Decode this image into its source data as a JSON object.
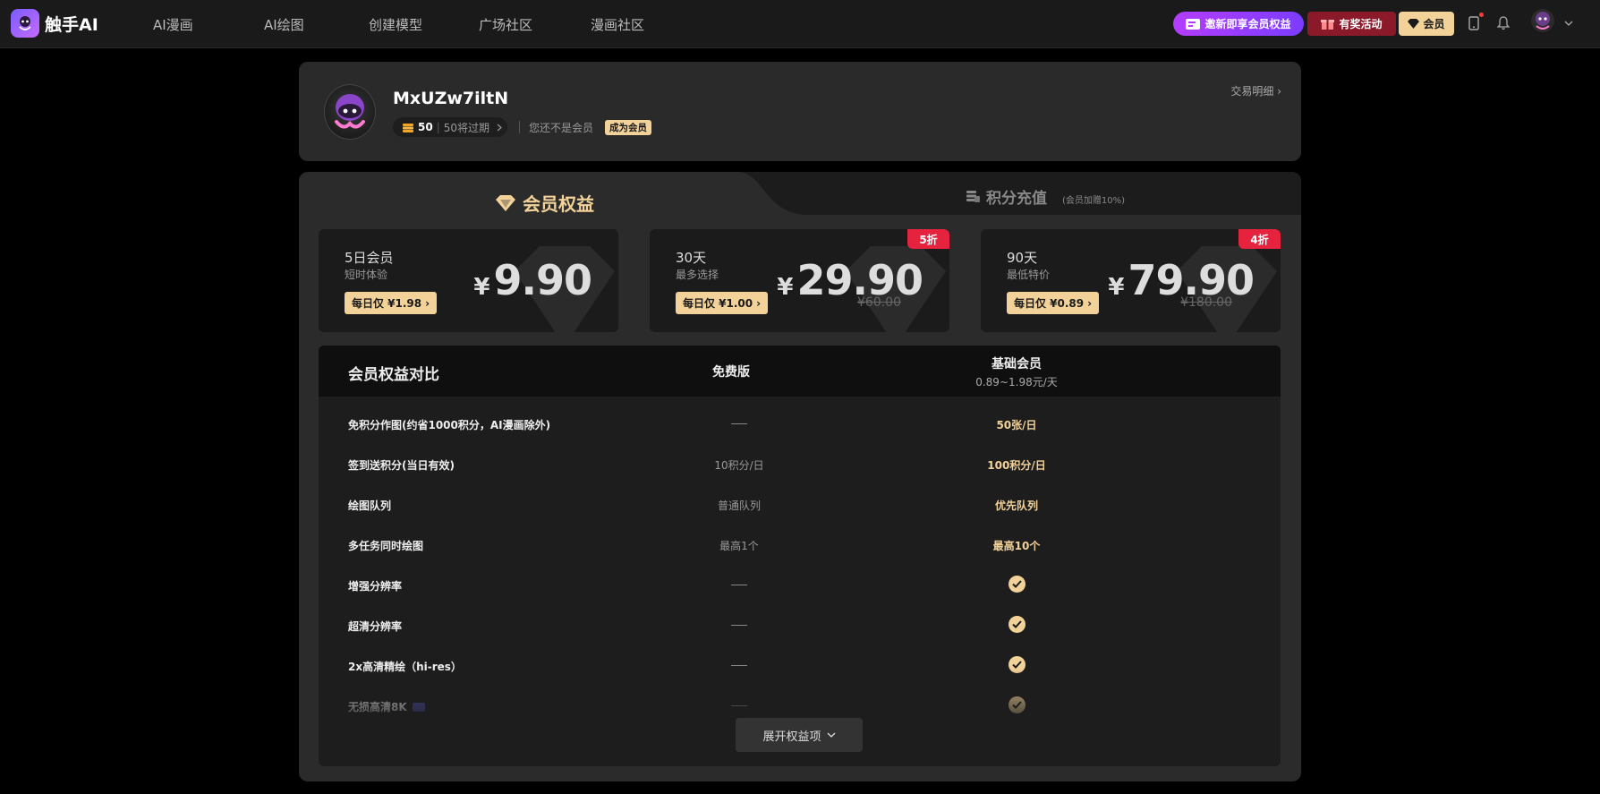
{
  "nav": {
    "logo_text": "触手AI",
    "items": [
      "AI漫画",
      "AI绘图",
      "创建模型",
      "广场社区",
      "漫画社区"
    ],
    "invite_label": "邀新即享会员权益",
    "reward_label": "有奖活动",
    "vip_label": "会员"
  },
  "profile": {
    "username": "MxUZw7iltN",
    "points": "50",
    "points_expiring": "50将过期",
    "not_member": "您还不是会员",
    "become_member": "成为会员",
    "transactions_link": "交易明细"
  },
  "tabs": {
    "vip": "会员权益",
    "points": "积分充值",
    "points_sub": "(会员加赠10%)"
  },
  "plans": [
    {
      "title": "5日会员",
      "subtitle": "短时体验",
      "daily": "每日仅 ¥1.98",
      "currency": "¥",
      "price": "9.90",
      "original": "",
      "badge": ""
    },
    {
      "title": "30天",
      "subtitle": "最多选择",
      "daily": "每日仅 ¥1.00",
      "currency": "¥",
      "price": "29.90",
      "original": "¥60.00",
      "badge": "5折"
    },
    {
      "title": "90天",
      "subtitle": "最低特价",
      "daily": "每日仅 ¥0.89",
      "currency": "¥",
      "price": "79.90",
      "original": "¥180.00",
      "badge": "4折"
    }
  ],
  "comparison": {
    "header": {
      "feature": "会员权益对比",
      "free": "免费版",
      "basic": "基础会员",
      "basic_sub": "0.89~1.98元/天"
    },
    "rows": [
      {
        "feature": "免积分作图(约省1000积分，AI漫画除外)",
        "free": "—",
        "basic": "50张/日"
      },
      {
        "feature": "签到送积分(当日有效)",
        "free": "10积分/日",
        "basic": "100积分/日"
      },
      {
        "feature": "绘图队列",
        "free": "普通队列",
        "basic": "优先队列"
      },
      {
        "feature": "多任务同时绘图",
        "free": "最高1个",
        "basic": "最高10个"
      },
      {
        "feature": "增强分辨率",
        "free": "—",
        "basic": "check"
      },
      {
        "feature": "超清分辨率",
        "free": "—",
        "basic": "check"
      },
      {
        "feature": "2x高清精绘（hi-res）",
        "free": "—",
        "basic": "check"
      },
      {
        "feature": "无损高清8K",
        "free": "—",
        "basic": "check"
      }
    ],
    "expand_label": "展开权益项"
  },
  "colors": {
    "gold": "#f3d29a",
    "badge_red": "#e5233f",
    "invite_purple": "#b43cff"
  }
}
